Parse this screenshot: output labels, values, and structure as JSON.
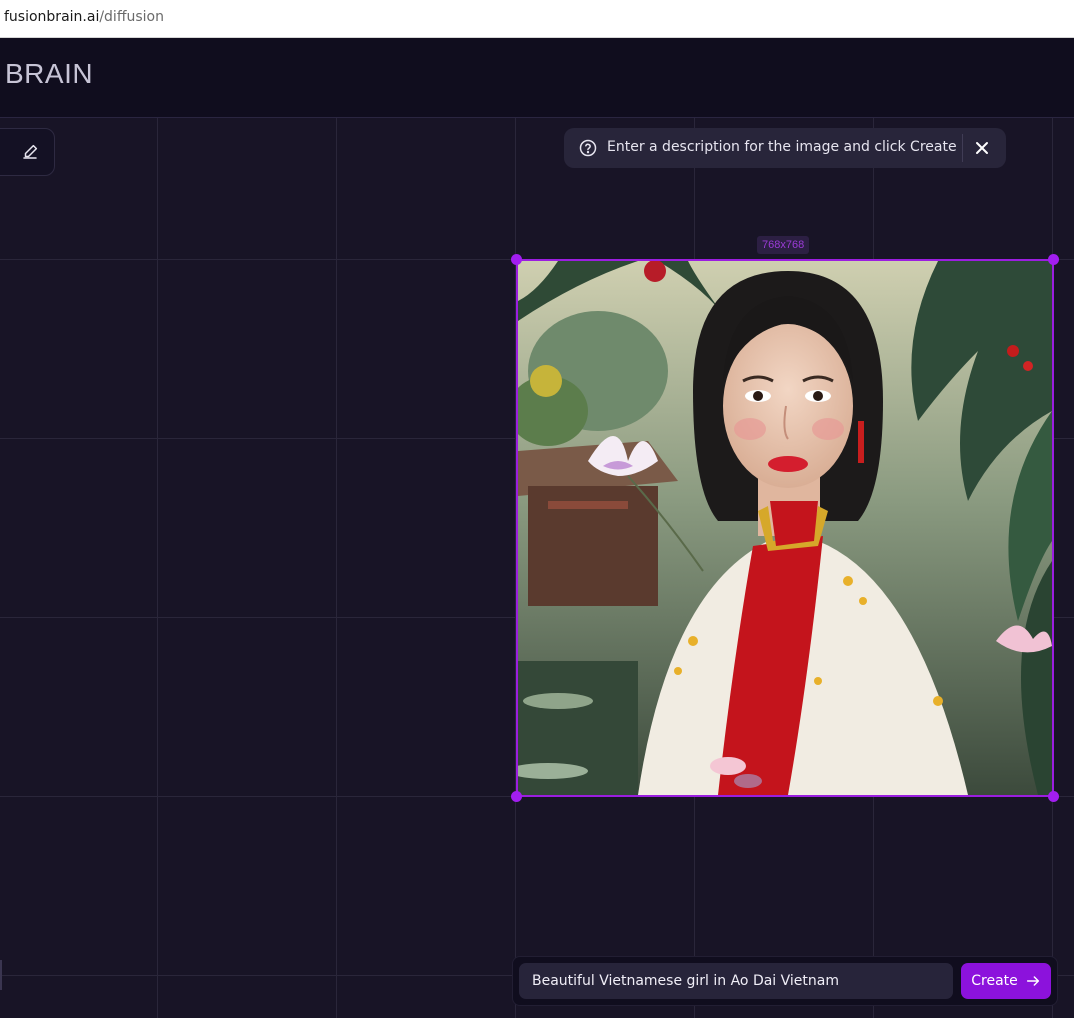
{
  "browser": {
    "url_host": "fusionbrain.ai",
    "url_path": "/diffusion"
  },
  "header": {
    "logo_text": "BRAIN"
  },
  "toolbar": {
    "eraser_icon": "eraser-icon"
  },
  "hint": {
    "icon": "help-circle-icon",
    "text": "Enter a description for the image and click Create",
    "close_icon": "close-icon"
  },
  "image": {
    "size_label": "768x768",
    "description": "Painted portrait of a Vietnamese woman in a white and red Ao Dai with lotus flowers and tropical leaves"
  },
  "prompt": {
    "value": "Beautiful Vietnamese girl in Ao Dai Vietnam",
    "create_label": "Create",
    "create_icon": "arrow-right-icon"
  },
  "colors": {
    "accent": "#9b1ee0",
    "button": "#8c12dc",
    "background": "#181426",
    "header": "#100d1e"
  }
}
